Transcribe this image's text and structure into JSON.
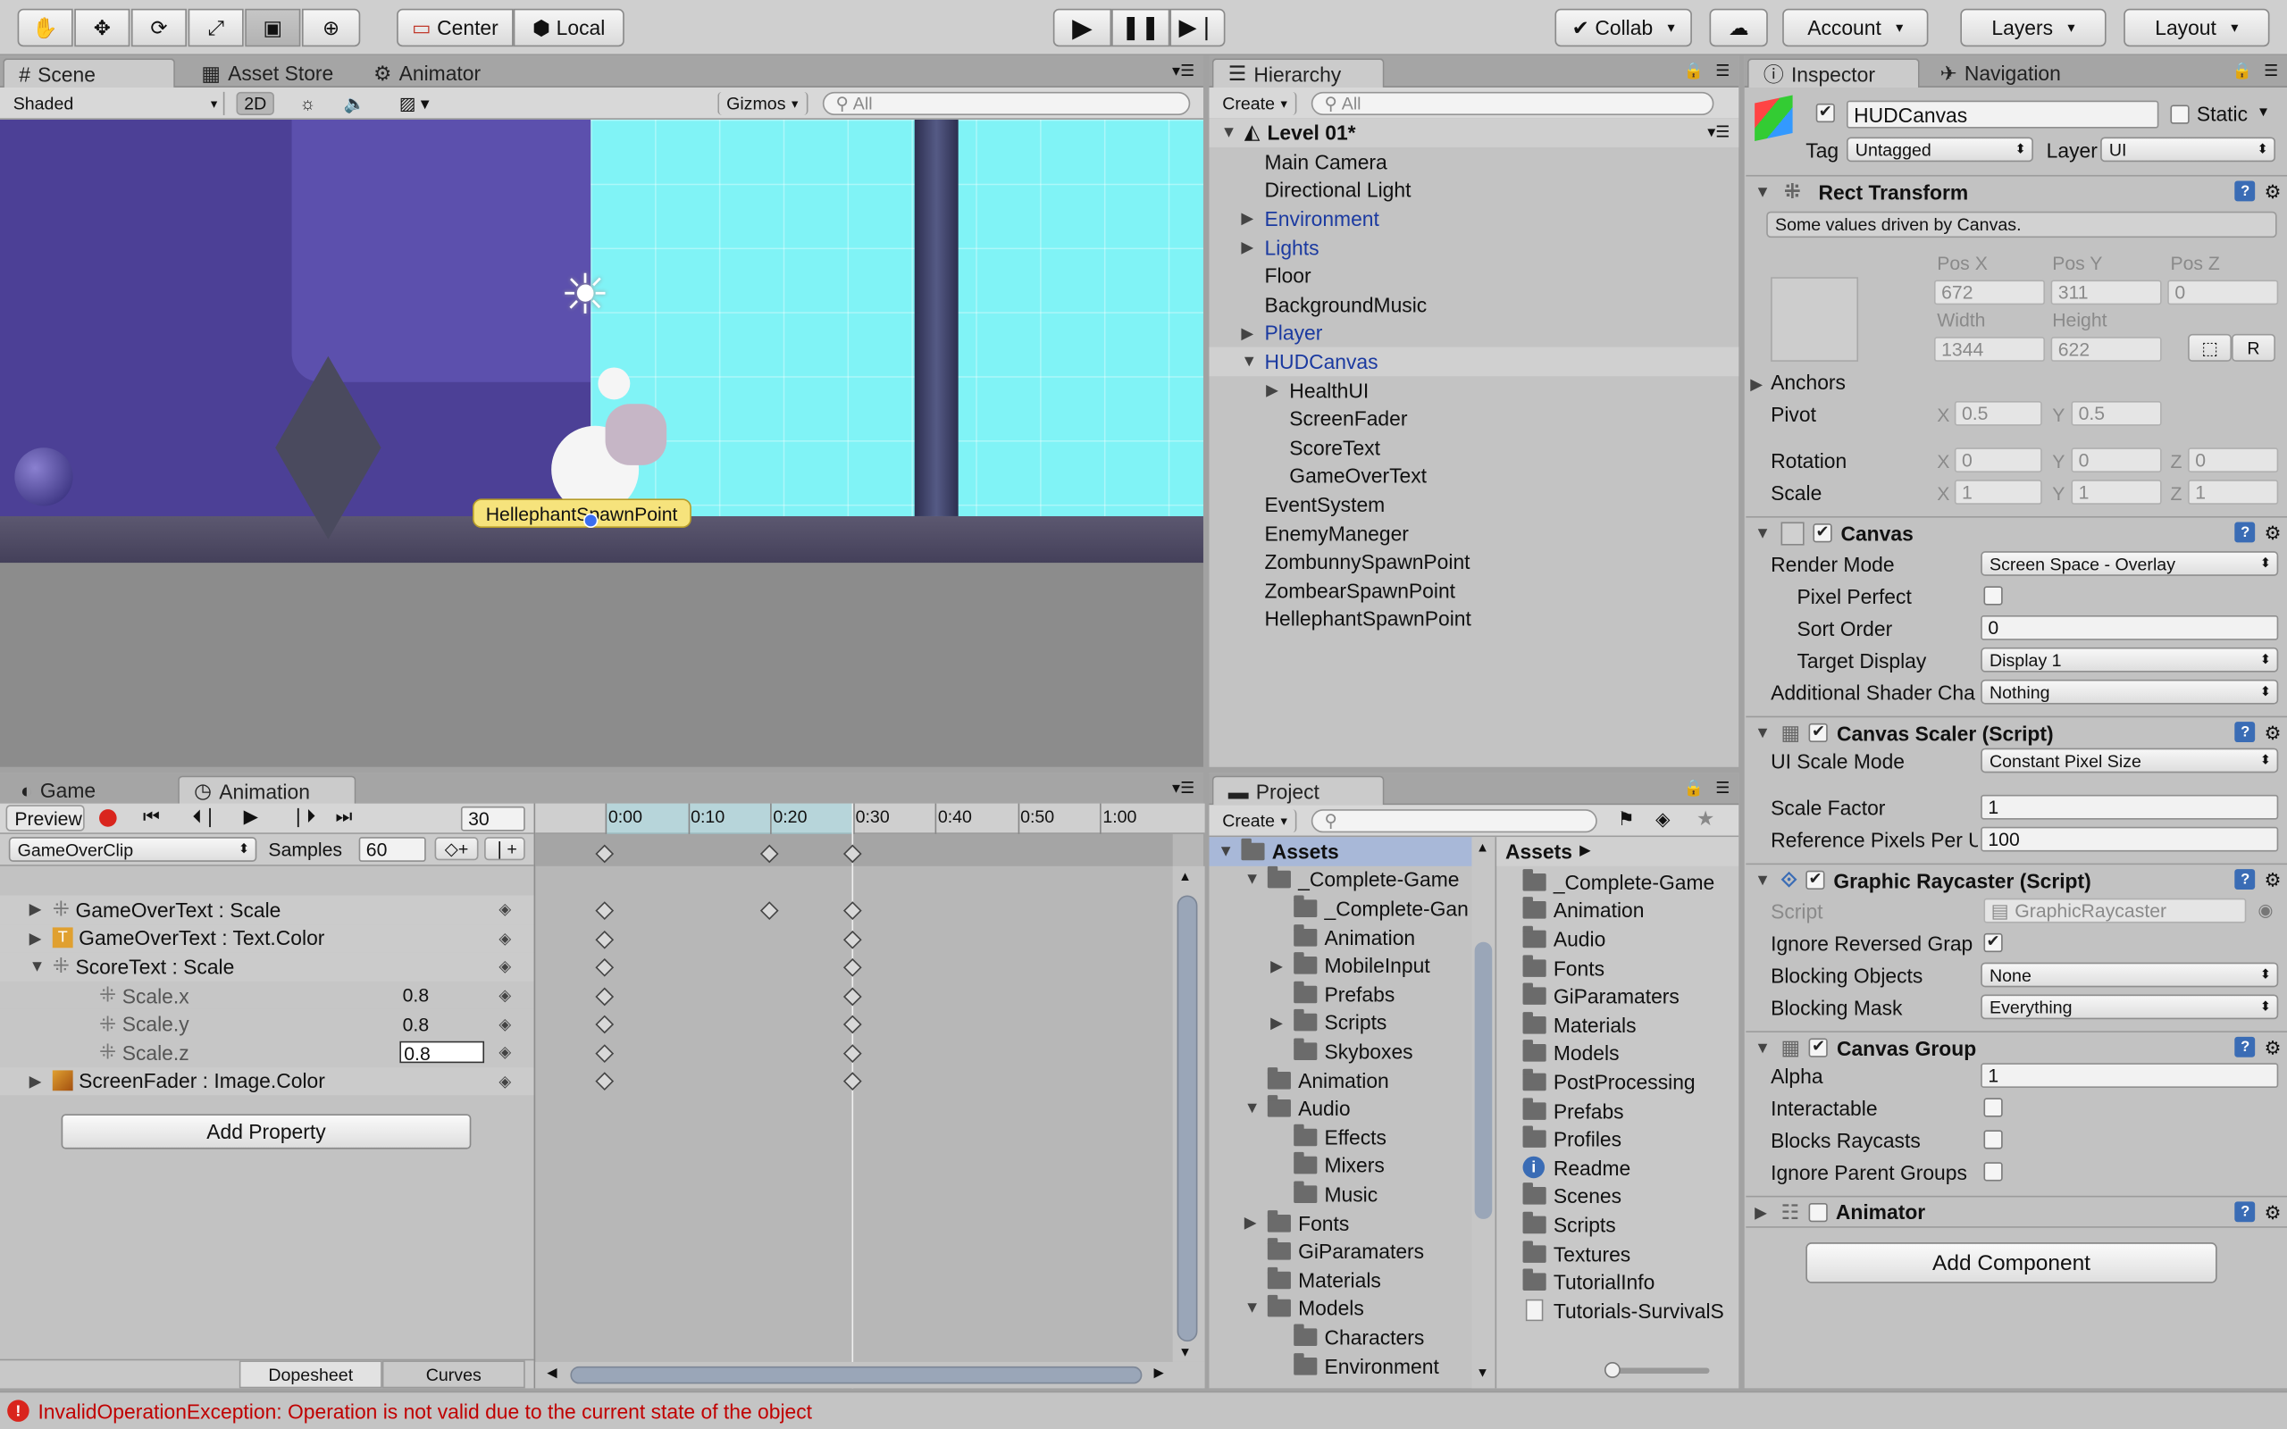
{
  "toolbar": {
    "center_label": "Center",
    "local_label": "Local",
    "collab_label": "Collab",
    "account_label": "Account",
    "layers_label": "Layers",
    "layout_label": "Layout"
  },
  "scene": {
    "tabs": [
      "Scene",
      "Asset Store",
      "Animator"
    ],
    "shading": "Shaded",
    "mode_2d": "2D",
    "gizmos": "Gizmos",
    "search_placeholder": "All",
    "object_label": "HellephantSpawnPoint"
  },
  "hierarchy": {
    "tab": "Hierarchy",
    "create": "Create",
    "search_placeholder": "All",
    "scene_name": "Level 01*",
    "items": [
      {
        "label": "Main Camera",
        "indent": 0,
        "arrow": "",
        "prefab": false
      },
      {
        "label": "Directional Light",
        "indent": 0,
        "arrow": "",
        "prefab": false
      },
      {
        "label": "Environment",
        "indent": 0,
        "arrow": "▶",
        "prefab": true
      },
      {
        "label": "Lights",
        "indent": 0,
        "arrow": "▶",
        "prefab": true
      },
      {
        "label": "Floor",
        "indent": 0,
        "arrow": "",
        "prefab": false
      },
      {
        "label": "BackgroundMusic",
        "indent": 0,
        "arrow": "",
        "prefab": false
      },
      {
        "label": "Player",
        "indent": 0,
        "arrow": "▶",
        "prefab": true
      },
      {
        "label": "HUDCanvas",
        "indent": 0,
        "arrow": "▼",
        "prefab": true
      },
      {
        "label": "HealthUI",
        "indent": 1,
        "arrow": "▶",
        "prefab": false
      },
      {
        "label": "ScreenFader",
        "indent": 1,
        "arrow": "",
        "prefab": false
      },
      {
        "label": "ScoreText",
        "indent": 1,
        "arrow": "",
        "prefab": false
      },
      {
        "label": "GameOverText",
        "indent": 1,
        "arrow": "",
        "prefab": false
      },
      {
        "label": "EventSystem",
        "indent": 0,
        "arrow": "",
        "prefab": false
      },
      {
        "label": "EnemyManeger",
        "indent": 0,
        "arrow": "",
        "prefab": false
      },
      {
        "label": "ZombunnySpawnPoint",
        "indent": 0,
        "arrow": "",
        "prefab": false
      },
      {
        "label": "ZombearSpawnPoint",
        "indent": 0,
        "arrow": "",
        "prefab": false
      },
      {
        "label": "HellephantSpawnPoint",
        "indent": 0,
        "arrow": "",
        "prefab": false
      }
    ]
  },
  "inspector": {
    "tabs": [
      "Inspector",
      "Navigation"
    ],
    "object_name": "HUDCanvas",
    "static_label": "Static",
    "tag_label": "Tag",
    "tag_value": "Untagged",
    "layer_label": "Layer",
    "layer_value": "UI",
    "rect": {
      "title": "Rect Transform",
      "note": "Some values driven by Canvas.",
      "posx_label": "Pos X",
      "posy_label": "Pos Y",
      "posz_label": "Pos Z",
      "posx": "672",
      "posy": "311",
      "posz": "0",
      "width_label": "Width",
      "height_label": "Height",
      "width": "1344",
      "height": "622",
      "r_label": "R",
      "anchors_label": "Anchors",
      "pivot_label": "Pivot",
      "pivot_x": "0.5",
      "pivot_y": "0.5",
      "rotation_label": "Rotation",
      "rot_x": "0",
      "rot_y": "0",
      "rot_z": "0",
      "scale_label": "Scale",
      "scale_x": "1",
      "scale_y": "1",
      "scale_z": "1",
      "x": "X",
      "y": "Y",
      "z": "Z"
    },
    "canvas": {
      "title": "Canvas",
      "render_mode_label": "Render Mode",
      "render_mode": "Screen Space - Overlay",
      "pixel_perfect_label": "Pixel Perfect",
      "sort_order_label": "Sort Order",
      "sort_order": "0",
      "target_display_label": "Target Display",
      "target_display": "Display 1",
      "shader_label": "Additional Shader Cha",
      "shader_value": "Nothing"
    },
    "scaler": {
      "title": "Canvas Scaler (Script)",
      "ui_scale_label": "UI Scale Mode",
      "ui_scale": "Constant Pixel Size",
      "scale_factor_label": "Scale Factor",
      "scale_factor": "1",
      "ref_pixels_label": "Reference Pixels Per U",
      "ref_pixels": "100"
    },
    "raycaster": {
      "title": "Graphic Raycaster (Script)",
      "script_label": "Script",
      "script_value": "GraphicRaycaster",
      "ignore_reversed_label": "Ignore Reversed Grap",
      "blocking_objects_label": "Blocking Objects",
      "blocking_objects": "None",
      "blocking_mask_label": "Blocking Mask",
      "blocking_mask": "Everything"
    },
    "group": {
      "title": "Canvas Group",
      "alpha_label": "Alpha",
      "alpha": "1",
      "interactable_label": "Interactable",
      "blocks_label": "Blocks Raycasts",
      "ignore_parent_label": "Ignore Parent Groups"
    },
    "animator_title": "Animator",
    "add_component": "Add Component"
  },
  "animation": {
    "tabs": [
      "Game",
      "Animation"
    ],
    "preview": "Preview",
    "frame": "30",
    "clip": "GameOverClip",
    "samples_label": "Samples",
    "samples": "60",
    "time_labels": [
      "0:00",
      "0:10",
      "0:20",
      "0:30",
      "0:40",
      "0:50",
      "1:00"
    ],
    "properties": [
      {
        "label": "GameOverText : Scale",
        "indent": 0,
        "arrow": "▶",
        "value": "",
        "icon": "scale"
      },
      {
        "label": "GameOverText : Text.Color",
        "indent": 0,
        "arrow": "▶",
        "value": "",
        "icon": "text"
      },
      {
        "label": "ScoreText : Scale",
        "indent": 0,
        "arrow": "▼",
        "value": "",
        "icon": "scale"
      },
      {
        "label": "Scale.x",
        "indent": 1,
        "arrow": "",
        "value": "0.8",
        "icon": "scale"
      },
      {
        "label": "Scale.y",
        "indent": 1,
        "arrow": "",
        "value": "0.8",
        "icon": "scale"
      },
      {
        "label": "Scale.z",
        "indent": 1,
        "arrow": "",
        "value": "0.8",
        "icon": "scale"
      },
      {
        "label": "ScreenFader : Image.Color",
        "indent": 0,
        "arrow": "▶",
        "value": "",
        "icon": "image"
      }
    ],
    "add_property": "Add Property",
    "dopesheet": "Dopesheet",
    "curves": "Curves"
  },
  "project": {
    "tab": "Project",
    "create": "Create",
    "tree": [
      {
        "label": "Assets",
        "indent": 0,
        "arrow": "▼"
      },
      {
        "label": "_Complete-Game",
        "indent": 1,
        "arrow": "▼"
      },
      {
        "label": "_Complete-Gan",
        "indent": 2,
        "arrow": ""
      },
      {
        "label": "Animation",
        "indent": 2,
        "arrow": ""
      },
      {
        "label": "MobileInput",
        "indent": 2,
        "arrow": "▶"
      },
      {
        "label": "Prefabs",
        "indent": 2,
        "arrow": ""
      },
      {
        "label": "Scripts",
        "indent": 2,
        "arrow": "▶"
      },
      {
        "label": "Skyboxes",
        "indent": 2,
        "arrow": ""
      },
      {
        "label": "Animation",
        "indent": 1,
        "arrow": ""
      },
      {
        "label": "Audio",
        "indent": 1,
        "arrow": "▼"
      },
      {
        "label": "Effects",
        "indent": 2,
        "arrow": ""
      },
      {
        "label": "Mixers",
        "indent": 2,
        "arrow": ""
      },
      {
        "label": "Music",
        "indent": 2,
        "arrow": ""
      },
      {
        "label": "Fonts",
        "indent": 1,
        "arrow": "▶"
      },
      {
        "label": "GiParamaters",
        "indent": 1,
        "arrow": ""
      },
      {
        "label": "Materials",
        "indent": 1,
        "arrow": ""
      },
      {
        "label": "Models",
        "indent": 1,
        "arrow": "▼"
      },
      {
        "label": "Characters",
        "indent": 2,
        "arrow": ""
      },
      {
        "label": "Environment",
        "indent": 2,
        "arrow": ""
      }
    ],
    "assets_header": "Assets",
    "assets": [
      {
        "label": "_Complete-Game",
        "kind": "folder"
      },
      {
        "label": "Animation",
        "kind": "folder"
      },
      {
        "label": "Audio",
        "kind": "folder"
      },
      {
        "label": "Fonts",
        "kind": "folder"
      },
      {
        "label": "GiParamaters",
        "kind": "folder"
      },
      {
        "label": "Materials",
        "kind": "folder"
      },
      {
        "label": "Models",
        "kind": "folder"
      },
      {
        "label": "PostProcessing",
        "kind": "folder"
      },
      {
        "label": "Prefabs",
        "kind": "folder"
      },
      {
        "label": "Profiles",
        "kind": "folder"
      },
      {
        "label": "Readme",
        "kind": "info"
      },
      {
        "label": "Scenes",
        "kind": "folder"
      },
      {
        "label": "Scripts",
        "kind": "folder"
      },
      {
        "label": "Textures",
        "kind": "folder"
      },
      {
        "label": "TutorialInfo",
        "kind": "folder"
      },
      {
        "label": "Tutorials-SurvivalS",
        "kind": "file"
      }
    ]
  },
  "status": {
    "message": "InvalidOperationException: Operation is not valid due to the current state of the object"
  },
  "colors": {
    "scene_sky": "#80f3f6",
    "scene_wall": "#5145a0",
    "selection": "#8aa8e0",
    "error": "#d9251d"
  }
}
